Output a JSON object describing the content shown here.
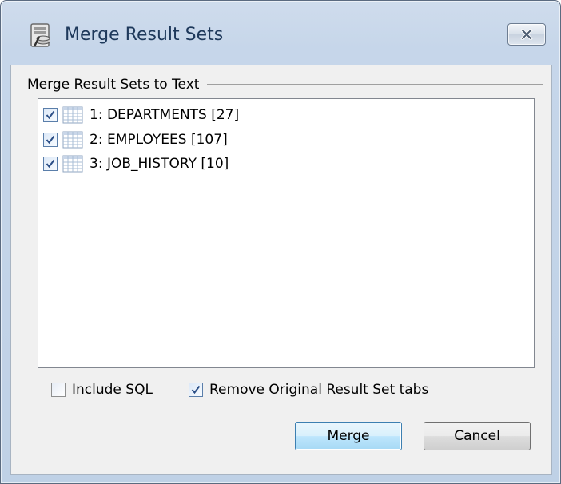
{
  "window": {
    "title": "Merge Result Sets",
    "close_icon": "close-x-icon"
  },
  "group": {
    "label": "Merge Result Sets to Text"
  },
  "result_sets": [
    {
      "label": "1: DEPARTMENTS [27]",
      "checked": true,
      "icon": "table-grid-icon"
    },
    {
      "label": "2: EMPLOYEES [107]",
      "checked": true,
      "icon": "table-grid-icon"
    },
    {
      "label": "3: JOB_HISTORY [10]",
      "checked": true,
      "icon": "table-grid-icon"
    }
  ],
  "options": {
    "include_sql": {
      "label": "Include SQL",
      "checked": false
    },
    "remove_tabs": {
      "label": "Remove Original Result Set tabs",
      "checked": true
    }
  },
  "buttons": {
    "merge": "Merge",
    "cancel": "Cancel"
  },
  "colors": {
    "title_text": "#1e395b",
    "default_button_border": "#3c7fb1",
    "check_mark": "#2b4e86"
  }
}
